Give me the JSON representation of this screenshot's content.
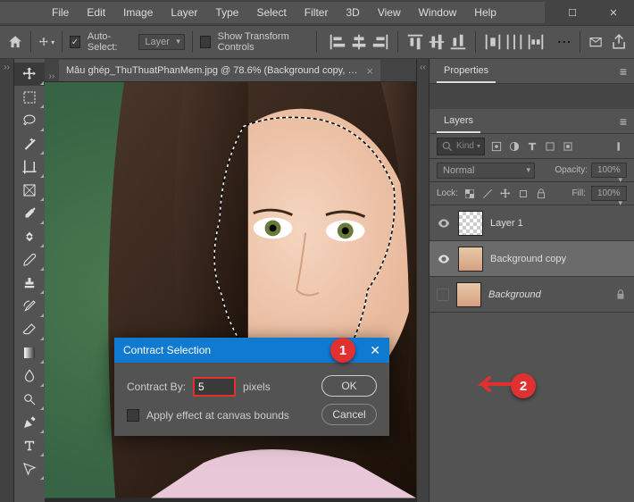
{
  "menu": [
    "File",
    "Edit",
    "Image",
    "Layer",
    "Type",
    "Select",
    "Filter",
    "3D",
    "View",
    "Window",
    "Help"
  ],
  "options": {
    "auto_select": "Auto-Select:",
    "layer_dd": "Layer",
    "transform": "Show Transform Controls"
  },
  "tab": {
    "name": "Mẫu ghép_ThuThuatPhanMem.jpg @ 78.6% (Background copy, R..."
  },
  "properties": {
    "title": "Properties"
  },
  "layers": {
    "title": "Layers",
    "kind": "Kind",
    "blend": "Normal",
    "opacity_label": "Opacity:",
    "opacity_val": "100%",
    "lock_label": "Lock:",
    "fill_label": "Fill:",
    "fill_val": "100%",
    "items": [
      {
        "name": "Layer 1",
        "visible": true,
        "checker": true
      },
      {
        "name": "Background copy",
        "visible": true,
        "selected": true
      },
      {
        "name": "Background",
        "visible": false,
        "locked": true,
        "italic": true
      }
    ]
  },
  "dialog": {
    "title": "Contract Selection",
    "contract_by": "Contract By:",
    "value": "5",
    "unit": "pixels",
    "apply_bounds": "Apply effect at canvas bounds",
    "ok": "OK",
    "cancel": "Cancel"
  },
  "callouts": {
    "one": "1",
    "two": "2"
  }
}
